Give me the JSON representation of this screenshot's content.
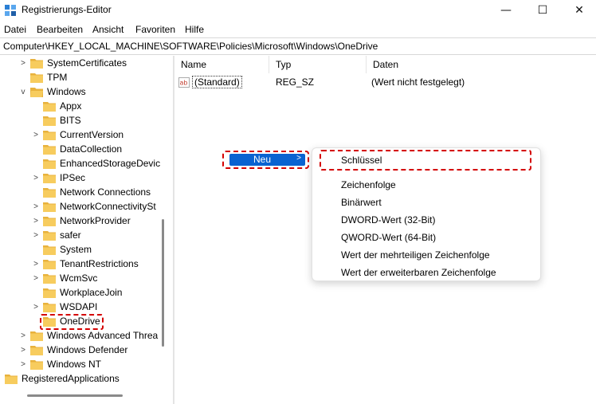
{
  "window": {
    "title": "Registrierungs-Editor",
    "controls": {
      "minimize": "—",
      "maximize": "☐",
      "close": "✕"
    }
  },
  "menu": [
    "Datei",
    "Bearbeiten",
    "Ansicht",
    "Favoriten",
    "Hilfe"
  ],
  "address": "Computer\\HKEY_LOCAL_MACHINE\\SOFTWARE\\Policies\\Microsoft\\Windows\\OneDrive",
  "tree": [
    {
      "label": "SystemCertificates",
      "chevron": ">"
    },
    {
      "label": "TPM",
      "chevron": ""
    },
    {
      "label": "Windows",
      "chevron": "v"
    },
    {
      "label": "Appx",
      "chevron": ""
    },
    {
      "label": "BITS",
      "chevron": ""
    },
    {
      "label": "CurrentVersion",
      "chevron": ">"
    },
    {
      "label": "DataCollection",
      "chevron": ""
    },
    {
      "label": "EnhancedStorageDevic",
      "chevron": ""
    },
    {
      "label": "IPSec",
      "chevron": ">"
    },
    {
      "label": "Network Connections",
      "chevron": ""
    },
    {
      "label": "NetworkConnectivitySt",
      "chevron": ">"
    },
    {
      "label": "NetworkProvider",
      "chevron": ">"
    },
    {
      "label": "safer",
      "chevron": ">"
    },
    {
      "label": "System",
      "chevron": ""
    },
    {
      "label": "TenantRestrictions",
      "chevron": ">"
    },
    {
      "label": "WcmSvc",
      "chevron": ">"
    },
    {
      "label": "WorkplaceJoin",
      "chevron": ""
    },
    {
      "label": "WSDAPI",
      "chevron": ">"
    },
    {
      "label": "OneDrive",
      "chevron": ""
    },
    {
      "label": "Windows Advanced Threa",
      "chevron": ">"
    },
    {
      "label": "Windows Defender",
      "chevron": ">"
    },
    {
      "label": "Windows NT",
      "chevron": ">"
    },
    {
      "label": "RegisteredApplications",
      "chevron": ""
    }
  ],
  "columns": {
    "name": "Name",
    "type": "Typ",
    "data": "Daten"
  },
  "values": [
    {
      "icon_text": "ab",
      "name": "(Standard)",
      "type": "REG_SZ",
      "data": "(Wert nicht festgelegt)"
    }
  ],
  "context_menu": {
    "new_label": "Neu",
    "arrow": ">",
    "submenu": [
      "Schlüssel",
      "Zeichenfolge",
      "Binärwert",
      "DWORD-Wert (32-Bit)",
      "QWORD-Wert (64-Bit)",
      "Wert der mehrteiligen Zeichenfolge",
      "Wert der erweiterbaren Zeichenfolge"
    ]
  },
  "colors": {
    "folder": "#f3c75a",
    "highlight": "#0a63d1",
    "annotation": "#d40000"
  },
  "icons": {
    "app": "registry-editor-icon",
    "folder": "folder-icon",
    "value": "string-value-icon"
  }
}
